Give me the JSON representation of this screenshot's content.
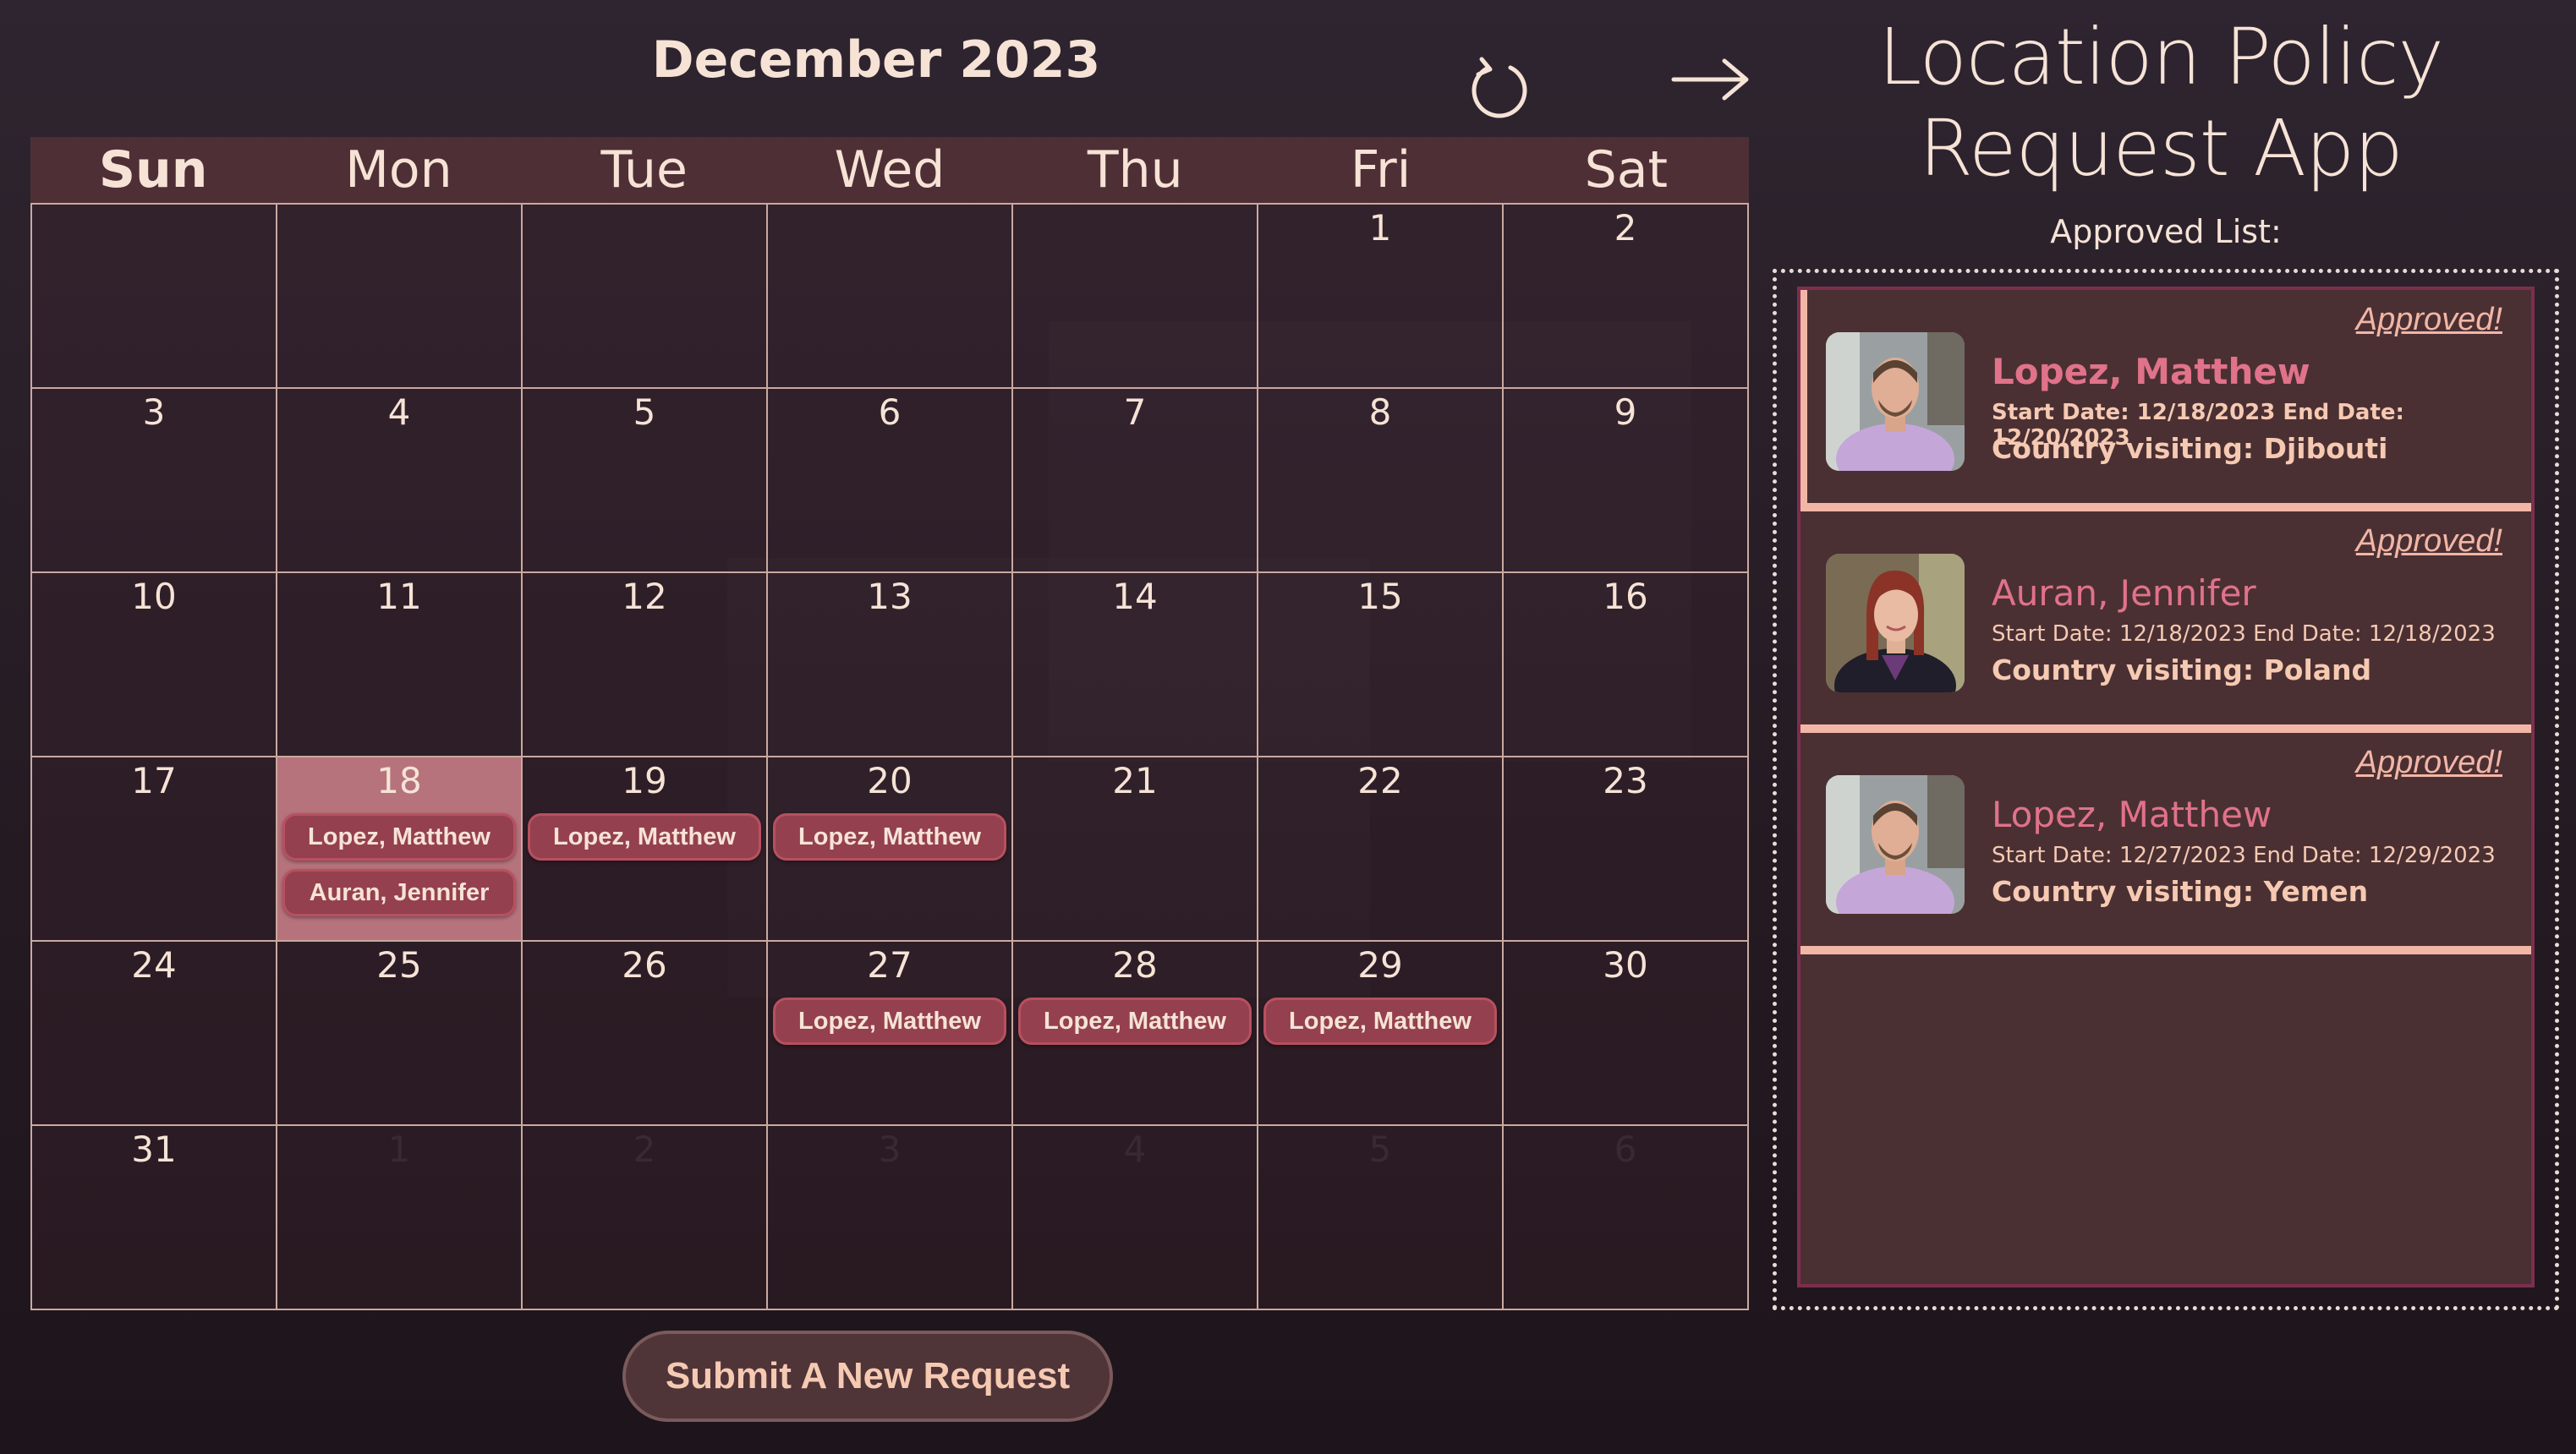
{
  "calendar": {
    "month_title": "December 2023",
    "weekdays": [
      "Sun",
      "Mon",
      "Tue",
      "Wed",
      "Thu",
      "Fri",
      "Sat"
    ],
    "days": [
      {
        "n": "",
        "other": true
      },
      {
        "n": "",
        "other": true
      },
      {
        "n": "",
        "other": true
      },
      {
        "n": "",
        "other": true
      },
      {
        "n": "",
        "other": true
      },
      {
        "n": "1"
      },
      {
        "n": "2"
      },
      {
        "n": "3"
      },
      {
        "n": "4"
      },
      {
        "n": "5"
      },
      {
        "n": "6"
      },
      {
        "n": "7"
      },
      {
        "n": "8"
      },
      {
        "n": "9"
      },
      {
        "n": "10"
      },
      {
        "n": "11"
      },
      {
        "n": "12"
      },
      {
        "n": "13"
      },
      {
        "n": "14"
      },
      {
        "n": "15"
      },
      {
        "n": "16"
      },
      {
        "n": "17"
      },
      {
        "n": "18",
        "today": true,
        "events": [
          "Lopez, Matthew",
          "Auran, Jennifer"
        ]
      },
      {
        "n": "19",
        "events": [
          "Lopez, Matthew"
        ]
      },
      {
        "n": "20",
        "events": [
          "Lopez, Matthew"
        ]
      },
      {
        "n": "21"
      },
      {
        "n": "22"
      },
      {
        "n": "23"
      },
      {
        "n": "24"
      },
      {
        "n": "25"
      },
      {
        "n": "26"
      },
      {
        "n": "27",
        "events": [
          "Lopez, Matthew"
        ]
      },
      {
        "n": "28",
        "events": [
          "Lopez, Matthew"
        ]
      },
      {
        "n": "29",
        "events": [
          "Lopez, Matthew"
        ]
      },
      {
        "n": "30"
      },
      {
        "n": "31"
      },
      {
        "n": "1",
        "other": true
      },
      {
        "n": "2",
        "other": true
      },
      {
        "n": "3",
        "other": true
      },
      {
        "n": "4",
        "other": true
      },
      {
        "n": "5",
        "other": true
      },
      {
        "n": "6",
        "other": true
      }
    ]
  },
  "header": {
    "app_title": "Location Policy Request App",
    "approved_list_label": "Approved List:",
    "refresh_icon": "refresh-icon",
    "arrow_icon": "right-arrow-icon"
  },
  "submit_button_label": "Submit A New Request",
  "approved_list": [
    {
      "status": "Approved!",
      "name": "Lopez, Matthew",
      "dates": "Start Date: 12/18/2023 End Date: 12/20/2023",
      "country": "Country visiting: Djibouti",
      "selected": true
    },
    {
      "status": "Approved!",
      "name": "Auran, Jennifer",
      "dates": "Start Date: 12/18/2023 End Date: 12/18/2023",
      "country": "Country visiting: Poland",
      "selected": false
    },
    {
      "status": "Approved!",
      "name": "Lopez, Matthew",
      "dates": "Start Date: 12/27/2023 End Date: 12/29/2023",
      "country": "Country visiting: Yemen",
      "selected": false
    }
  ],
  "colors": {
    "accent_pink": "#e0728a",
    "event_chip": "#94404f",
    "today_cell": "#b6737c",
    "separator": "#f2b6a6"
  }
}
